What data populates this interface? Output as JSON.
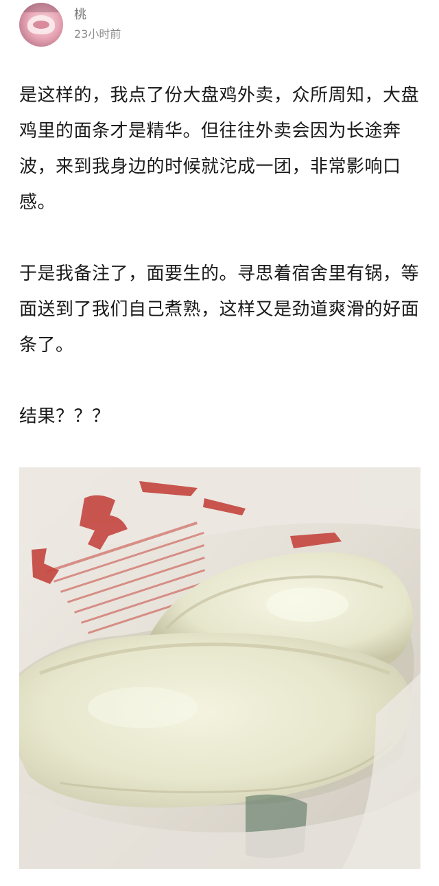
{
  "post": {
    "author": {
      "name": "桃",
      "avatar_icon": "profile-photo-icon"
    },
    "timestamp": "23小时前",
    "paragraphs": [
      "是这样的，我点了份大盘鸡外卖，众所周知，大盘鸡里的面条才是精华。但往往外卖会因为长途奔波，来到我身边的时候就沱成一团，非常影响口感。",
      "于是我备注了，面要生的。寻思着宿舍里有锅，等面送到了我们自己煮熟，这样又是劲道爽滑的好面条了。",
      "结果？？？"
    ],
    "photo": {
      "icon": "food-photo-icon",
      "colors": {
        "bag": "#e9e4dc",
        "print_red": "#c0302e",
        "dough": "#eeeed8",
        "dough_shadow": "#c9c6a8"
      }
    }
  }
}
